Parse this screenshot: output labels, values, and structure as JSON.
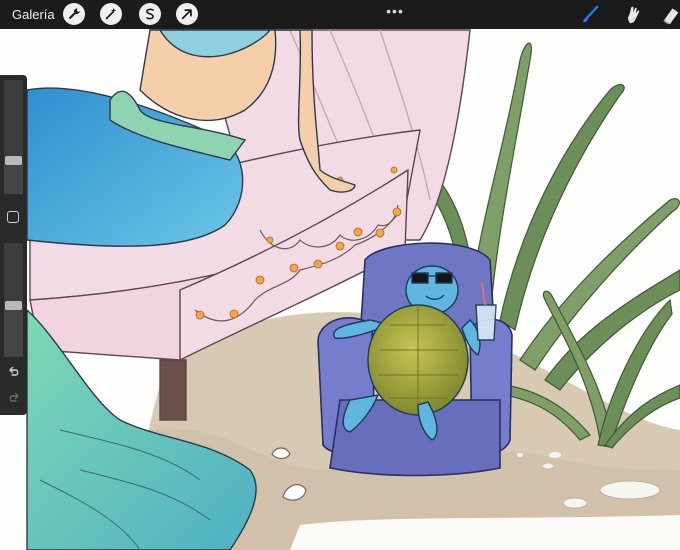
{
  "topbar": {
    "gallery_label": "Galería",
    "more_label": "•••",
    "left_tools": [
      {
        "icon": "wrench-icon"
      },
      {
        "icon": "magic-wand-icon"
      },
      {
        "icon": "selection-s-icon"
      },
      {
        "icon": "transform-arrow-icon"
      }
    ],
    "right_tools": [
      {
        "icon": "brush-icon",
        "active": true,
        "color": "#2f7df6"
      },
      {
        "icon": "smudge-icon"
      },
      {
        "icon": "eraser-icon"
      }
    ]
  },
  "sidebar": {
    "brush_size_level": 0.28,
    "opacity_level": 0.45,
    "modify_button_icon": "square-icon",
    "undo_icon": "undo-arrow-icon",
    "redo_icon": "redo-arrow-icon"
  },
  "colors": {
    "toolbar": "#1b1b1b",
    "chair_pink": "#f3dbe6",
    "armchair_blue": "#7078c8",
    "tail_blue": "#4aa8d8",
    "fin_green": "#8fd4b0",
    "sand": "#d9cbb7",
    "seaweed": "#6f8f5a"
  }
}
